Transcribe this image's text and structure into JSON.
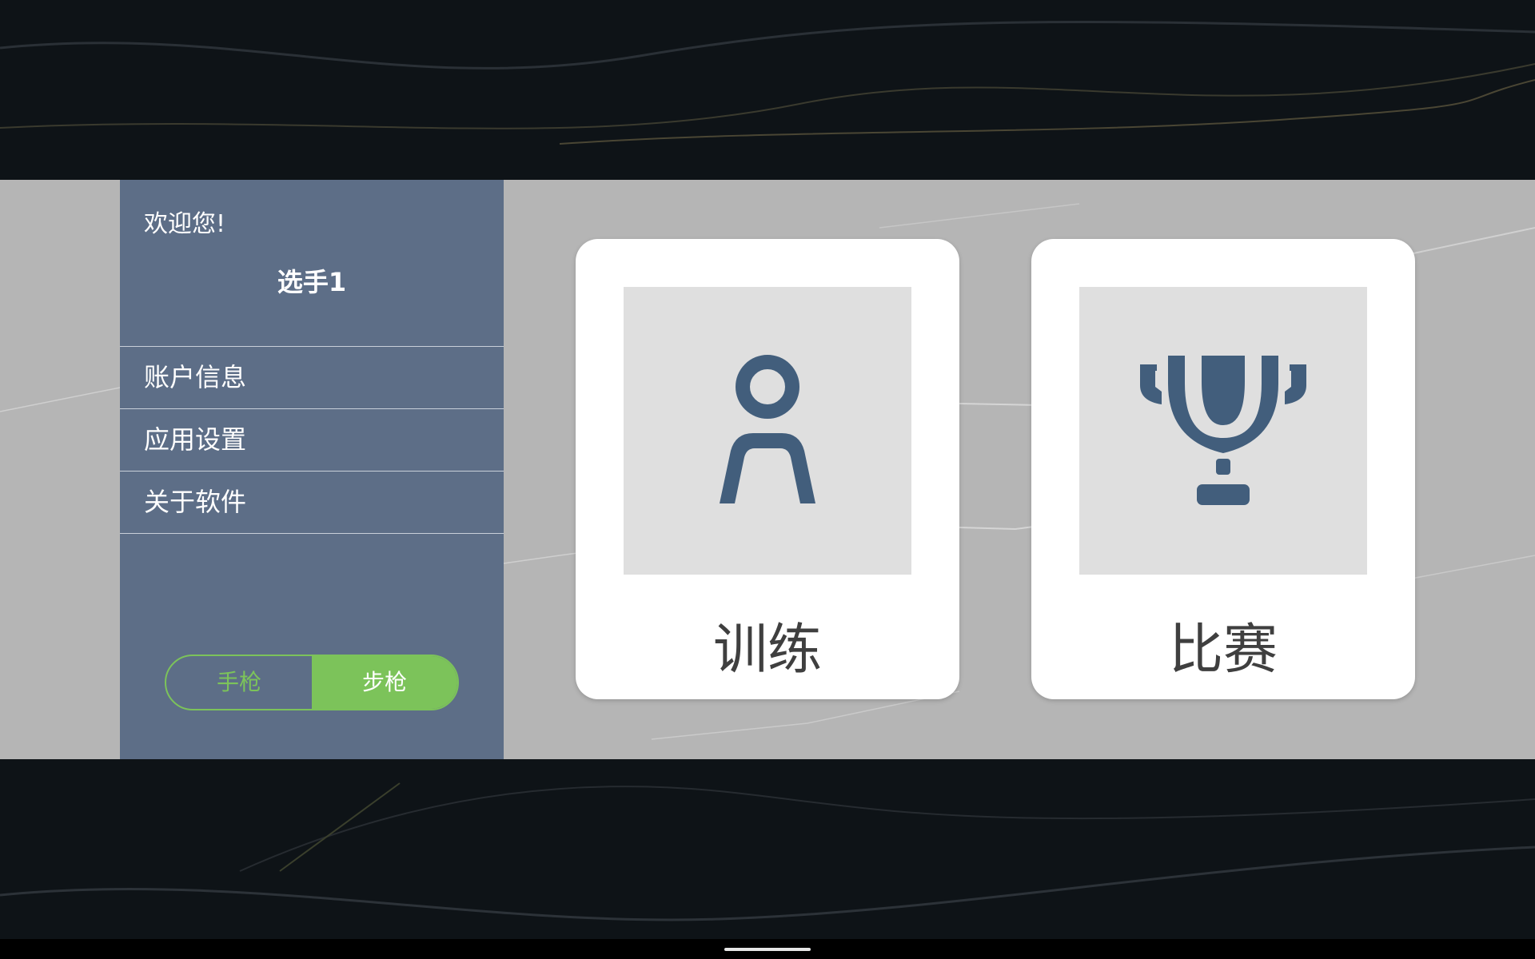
{
  "sidebar": {
    "welcome": "欢迎您!",
    "player_name": "选手1",
    "menu": [
      {
        "label": "账户信息"
      },
      {
        "label": "应用设置"
      },
      {
        "label": "关于软件"
      }
    ],
    "weapon_toggle": {
      "options": [
        "手枪",
        "步枪"
      ],
      "selected": "步枪"
    }
  },
  "cards": [
    {
      "label": "训练",
      "icon": "person-icon"
    },
    {
      "label": "比赛",
      "icon": "trophy-icon"
    }
  ],
  "colors": {
    "sidebar_bg": "#5d6e87",
    "accent_green": "#7cc35a",
    "icon_blue": "#425e7c",
    "band_bg": "#b5b5b5"
  }
}
